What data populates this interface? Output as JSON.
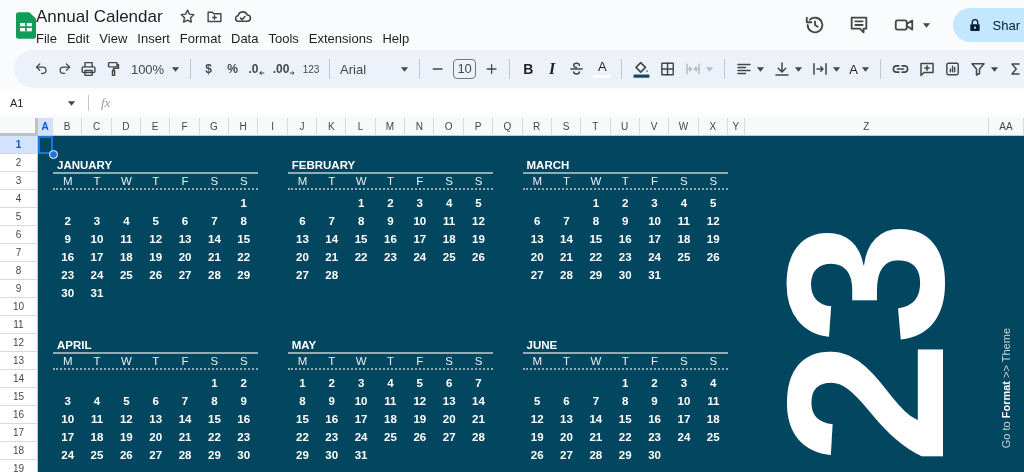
{
  "document": {
    "title": "Annual Calendar"
  },
  "menu": [
    "File",
    "Edit",
    "View",
    "Insert",
    "Format",
    "Data",
    "Tools",
    "Extensions",
    "Help"
  ],
  "share_button": {
    "label": "Shar"
  },
  "toolbar": {
    "zoom": "100%",
    "number_formats": [
      "$",
      "%",
      ".0",
      ".00",
      "123"
    ],
    "font": "Arial",
    "font_size": "10",
    "bold": "B",
    "italic": "I",
    "text_color": "A",
    "text_rotation": "A"
  },
  "formula_bar": {
    "cell_ref": "A1",
    "fx": "fx"
  },
  "columns": [
    {
      "label": "A",
      "selected": true
    },
    {
      "label": "B",
      "selected": false
    },
    {
      "label": "C",
      "selected": false
    },
    {
      "label": "D",
      "selected": false
    },
    {
      "label": "E",
      "selected": false
    },
    {
      "label": "F",
      "selected": false
    },
    {
      "label": "G",
      "selected": false
    },
    {
      "label": "H",
      "selected": false
    },
    {
      "label": "I",
      "selected": false
    },
    {
      "label": "J",
      "selected": false
    },
    {
      "label": "K",
      "selected": false
    },
    {
      "label": "L",
      "selected": false
    },
    {
      "label": "M",
      "selected": false
    },
    {
      "label": "N",
      "selected": false
    },
    {
      "label": "O",
      "selected": false
    },
    {
      "label": "P",
      "selected": false
    },
    {
      "label": "Q",
      "selected": false
    },
    {
      "label": "R",
      "selected": false
    },
    {
      "label": "S",
      "selected": false
    },
    {
      "label": "T",
      "selected": false
    },
    {
      "label": "U",
      "selected": false
    },
    {
      "label": "V",
      "selected": false
    },
    {
      "label": "W",
      "selected": false
    },
    {
      "label": "X",
      "selected": false
    },
    {
      "label": "Y",
      "selected": false
    },
    {
      "label": "Z",
      "selected": false
    },
    {
      "label": "AA",
      "selected": false
    }
  ],
  "rows": [
    {
      "label": "1",
      "selected": true
    },
    {
      "label": "2",
      "selected": false
    },
    {
      "label": "3",
      "selected": false
    },
    {
      "label": "4",
      "selected": false
    },
    {
      "label": "5",
      "selected": false
    },
    {
      "label": "6",
      "selected": false
    },
    {
      "label": "7",
      "selected": false
    },
    {
      "label": "8",
      "selected": false
    },
    {
      "label": "9",
      "selected": false
    },
    {
      "label": "10",
      "selected": false
    },
    {
      "label": "11",
      "selected": false
    },
    {
      "label": "12",
      "selected": false
    },
    {
      "label": "13",
      "selected": false
    },
    {
      "label": "14",
      "selected": false
    },
    {
      "label": "15",
      "selected": false
    },
    {
      "label": "16",
      "selected": false
    },
    {
      "label": "17",
      "selected": false
    },
    {
      "label": "18",
      "selected": false
    },
    {
      "label": "19",
      "selected": false
    }
  ],
  "months": [
    {
      "name": "JANUARY",
      "weekdays": [
        "M",
        "T",
        "W",
        "T",
        "F",
        "S",
        "S"
      ],
      "first_week": [
        "1"
      ],
      "weeks": [
        [
          "2",
          "3",
          "4",
          "5",
          "6",
          "7",
          "8"
        ],
        [
          "9",
          "10",
          "11",
          "12",
          "13",
          "14",
          "15"
        ],
        [
          "16",
          "17",
          "18",
          "19",
          "20",
          "21",
          "22"
        ],
        [
          "23",
          "24",
          "25",
          "26",
          "27",
          "28",
          "29"
        ],
        [
          "30",
          "31"
        ]
      ]
    },
    {
      "name": "FEBRUARY",
      "weekdays": [
        "M",
        "T",
        "W",
        "T",
        "F",
        "S",
        "S"
      ],
      "first_week": [
        "1",
        "2",
        "3",
        "4",
        "5"
      ],
      "weeks": [
        [
          "6",
          "7",
          "8",
          "9",
          "10",
          "11",
          "12"
        ],
        [
          "13",
          "14",
          "15",
          "16",
          "17",
          "18",
          "19"
        ],
        [
          "20",
          "21",
          "22",
          "23",
          "24",
          "25",
          "26"
        ],
        [
          "27",
          "28"
        ]
      ]
    },
    {
      "name": "MARCH",
      "weekdays": [
        "M",
        "T",
        "W",
        "T",
        "F",
        "S",
        "S"
      ],
      "first_week": [
        "1",
        "2",
        "3",
        "4",
        "5"
      ],
      "weeks": [
        [
          "6",
          "7",
          "8",
          "9",
          "10",
          "11",
          "12"
        ],
        [
          "13",
          "14",
          "15",
          "16",
          "17",
          "18",
          "19"
        ],
        [
          "20",
          "21",
          "22",
          "23",
          "24",
          "25",
          "26"
        ],
        [
          "27",
          "28",
          "29",
          "30",
          "31"
        ]
      ]
    },
    {
      "name": "APRIL",
      "weekdays": [
        "M",
        "T",
        "W",
        "T",
        "F",
        "S",
        "S"
      ],
      "first_week": [
        "1",
        "2"
      ],
      "weeks": [
        [
          "3",
          "4",
          "5",
          "6",
          "7",
          "8",
          "9"
        ],
        [
          "10",
          "11",
          "12",
          "13",
          "14",
          "15",
          "16"
        ],
        [
          "17",
          "18",
          "19",
          "20",
          "21",
          "22",
          "23"
        ],
        [
          "24",
          "25",
          "26",
          "27",
          "28",
          "29",
          "30"
        ]
      ]
    },
    {
      "name": "MAY",
      "weekdays": [
        "M",
        "T",
        "W",
        "T",
        "F",
        "S",
        "S"
      ],
      "first_week": [
        "1",
        "2",
        "3",
        "4",
        "5",
        "6",
        "7"
      ],
      "weeks": [
        [
          "8",
          "9",
          "10",
          "11",
          "12",
          "13",
          "14"
        ],
        [
          "15",
          "16",
          "17",
          "18",
          "19",
          "20",
          "21"
        ],
        [
          "22",
          "23",
          "24",
          "25",
          "26",
          "27",
          "28"
        ],
        [
          "29",
          "30",
          "31"
        ]
      ]
    },
    {
      "name": "JUNE",
      "weekdays": [
        "M",
        "T",
        "W",
        "T",
        "F",
        "S",
        "S"
      ],
      "first_week": [
        "1",
        "2",
        "3",
        "4"
      ],
      "weeks": [
        [
          "5",
          "6",
          "7",
          "8",
          "9",
          "10",
          "11"
        ],
        [
          "12",
          "13",
          "14",
          "15",
          "16",
          "17",
          "18"
        ],
        [
          "19",
          "20",
          "21",
          "22",
          "23",
          "24",
          "25"
        ],
        [
          "26",
          "27",
          "28",
          "29",
          "30"
        ]
      ]
    }
  ],
  "year": "23",
  "hint": "Go to **Format** >> Theme"
}
